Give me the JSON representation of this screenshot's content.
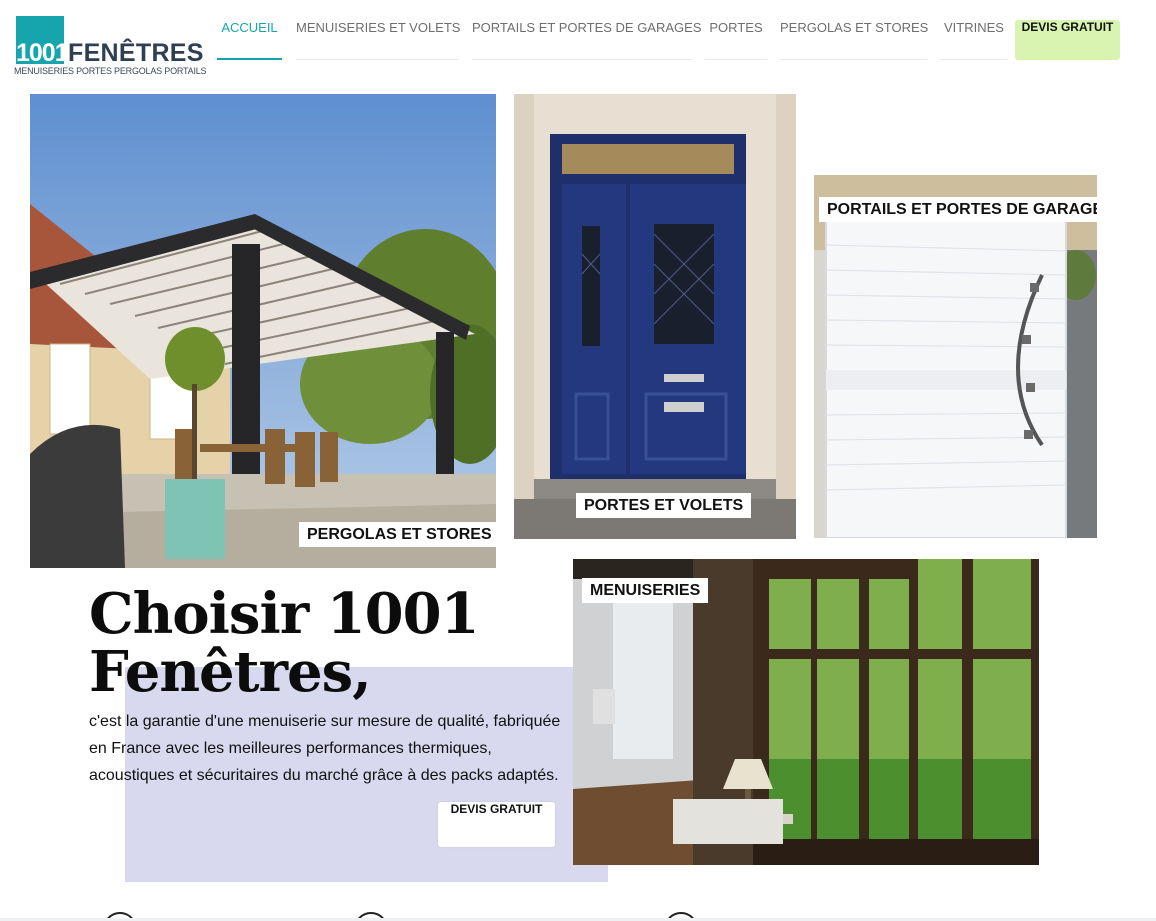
{
  "brand": {
    "number": "1001",
    "name": "FENÊTRES",
    "tagline": "MENUISERIES PORTES PERGOLAS PORTAILS",
    "color": "#17a5ad",
    "text_color": "#2f3f52"
  },
  "nav": {
    "items": [
      {
        "label": "ACCUEIL",
        "active": true
      },
      {
        "label": "MENUISERIES ET VOLETS",
        "active": false
      },
      {
        "label": "PORTAILS ET PORTES DE GARAGES",
        "active": false
      },
      {
        "label": "PORTES",
        "active": false
      },
      {
        "label": "PERGOLAS ET STORES",
        "active": false
      },
      {
        "label": "VITRINES",
        "active": false
      }
    ],
    "cta": "DEVIS GRATUIT",
    "cta_color": "#d9f3b0"
  },
  "tiles": {
    "pergolas": {
      "caption": "PERGOLAS ET STORES",
      "image": "pergola-photo"
    },
    "portes": {
      "caption": "PORTES ET VOLETS",
      "image": "blue-door-photo"
    },
    "portails": {
      "caption": "PORTAILS ET PORTES DE GARAGES",
      "image": "white-gate-photo"
    },
    "menuiseries": {
      "caption": "MENUISERIES",
      "image": "wooden-windows-photo"
    }
  },
  "hero": {
    "headline_line1": "Choisir 1001",
    "headline_line2": "Fenêtres,",
    "body": "c'est la garantie d'une menuiserie sur mesure de qualité, fabriquée en France avec les meilleures performances thermiques, acoustiques et sécuritaires du marché grâce à des packs adaptés.",
    "cta": "DEVIS GRATUIT",
    "accent_bg": "#d8d8ee"
  }
}
